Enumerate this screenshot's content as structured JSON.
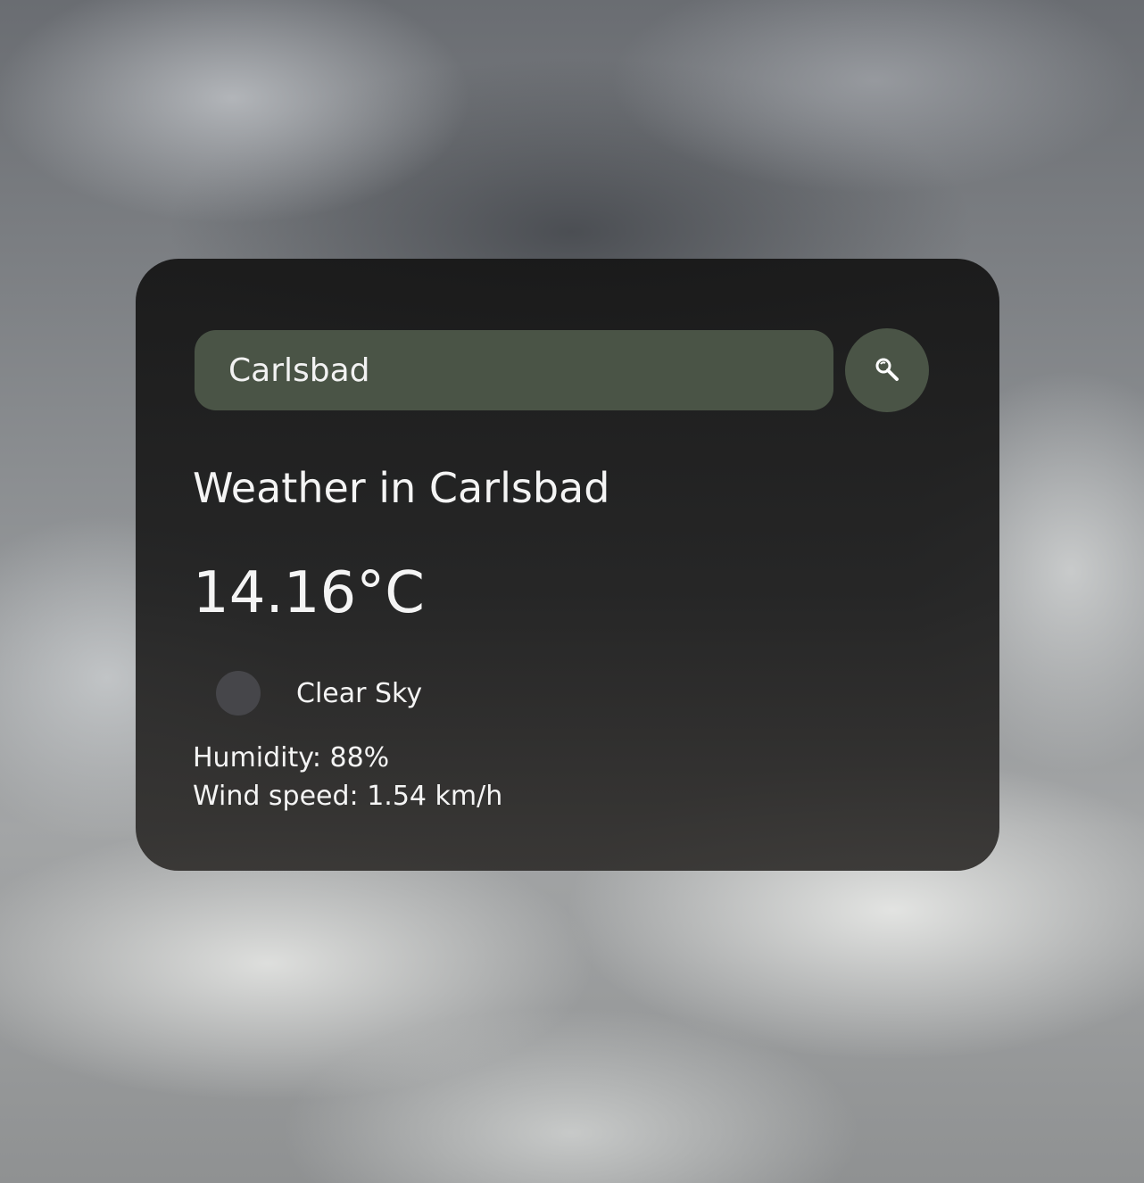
{
  "search": {
    "value": "Carlsbad",
    "button_icon": "search-icon"
  },
  "weather": {
    "title": "Weather in Carlsbad",
    "temperature": "14.16°C",
    "condition_icon": "weather-condition-icon",
    "condition": "Clear Sky",
    "humidity": "Humidity: 88%",
    "wind": "Wind speed: 1.54 km/h"
  },
  "colors": {
    "accent": "#4a5446",
    "card": "#1e1e1e",
    "text": "#f4f4f4"
  }
}
